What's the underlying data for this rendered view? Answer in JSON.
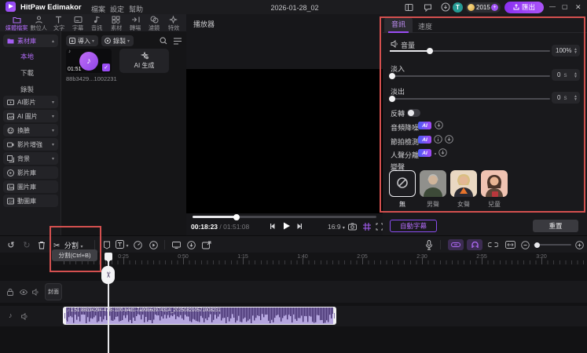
{
  "titlebar": {
    "app_title": "HitPaw Edimakor",
    "menu_file": "檔案",
    "menu_settings": "設定",
    "menu_help": "幫助",
    "document_title": "2026-01-28_02",
    "coins": "2015",
    "export_label": "匯出"
  },
  "media_tabs": [
    "媒體檔案",
    "數位人",
    "文字",
    "字幕",
    "音訊",
    "素材",
    "轉場",
    "濾鏡",
    "特效"
  ],
  "sidebar": {
    "group_label": "素材庫",
    "local_items": [
      "本地",
      "下載",
      "錄製"
    ],
    "ai_items": [
      "AI影片",
      "AI 圖片",
      "換臉",
      "影片增強",
      "背景"
    ],
    "lib_items": [
      "影片庫",
      "圖片庫",
      "動圖庫"
    ]
  },
  "media_panel": {
    "import_label": "導入",
    "record_label": "錄製",
    "clip_duration": "01:51",
    "clip_filename": "88b3429...1002231",
    "ai_generate_label": "AI 生成"
  },
  "player": {
    "title": "播放器",
    "current_time": "00:18:23",
    "time_sep": "/",
    "total_time": "01:51:08",
    "ratio": "16:9"
  },
  "audio_panel": {
    "tab_audio": "音訊",
    "tab_speed": "速度",
    "volume_label": "音量",
    "volume_value": "100%",
    "fade_in_label": "淡入",
    "fade_in_value": "0",
    "fade_in_unit": "s",
    "fade_out_label": "淡出",
    "fade_out_value": "0",
    "fade_out_unit": "s",
    "reverse_label": "反轉",
    "denoise_label": "音頻降噪",
    "beat_label": "節拍檢測",
    "vocal_label": "人聲分離",
    "ai_badge": "AI",
    "voice_label": "變聲",
    "voice_options": [
      "無",
      "男聲",
      "女聲",
      "兒童"
    ],
    "auto_subtitle_label": "自動字幕",
    "reset_label": "重置"
  },
  "timeline": {
    "split_label": "分割",
    "split_tooltip": "分割(Ctrl+B)",
    "cover_label": "封面",
    "ruler_labels": [
      "0:25",
      "0:50",
      "1:15",
      "1:40",
      "2:05",
      "2:30",
      "2:55",
      "3:20"
    ],
    "clip_label": "1:51  88b34294-47f8-11f0-b4d1-7a99b6d974314_202508210571008231"
  },
  "icons": {
    "chevron_down": "▾",
    "chevron_up": "▴",
    "play": "▶",
    "prev": "◀",
    "next": "▶",
    "music_note": "♪",
    "scissors": "✂",
    "undo": "↺",
    "redo": "↻",
    "check": "✓",
    "close": "✕",
    "minimize": "—",
    "maximize": "▢",
    "plus": "+",
    "sparkle": "✦",
    "letter_t": "T",
    "info": "i",
    "down_arrow": "↓",
    "minus": "−"
  },
  "colors": {
    "accent": "#9b4df5",
    "highlight": "#d4504f",
    "clip_bg": "#b5a6df",
    "clip_wave": "#43306e"
  }
}
